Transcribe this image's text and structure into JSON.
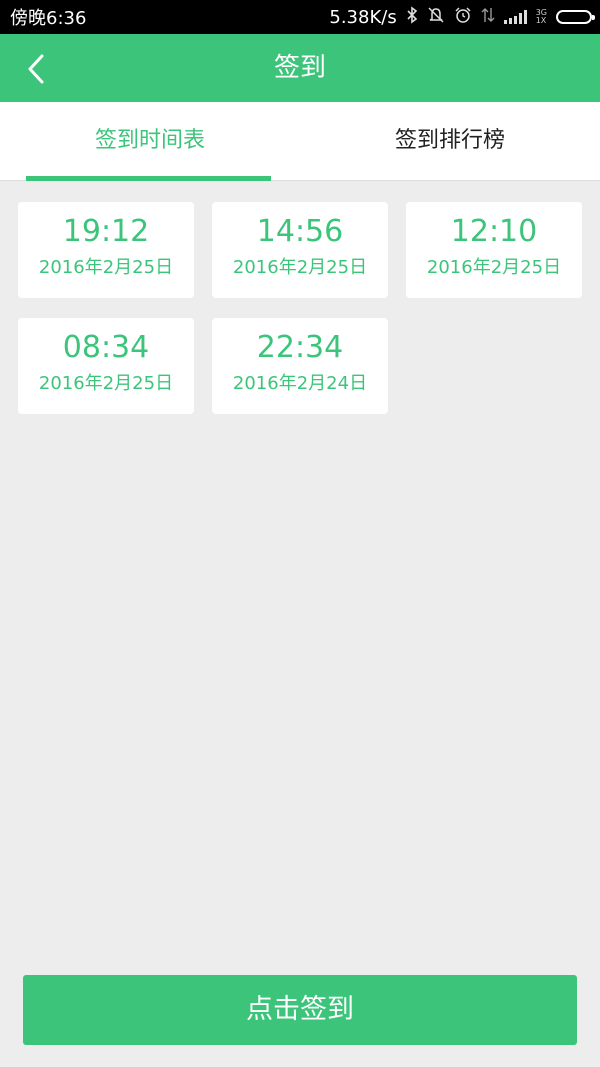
{
  "status_bar": {
    "time": "傍晚6:36",
    "network_speed": "5.38K/s",
    "net_type_top": "3G",
    "net_type_bottom": "1X",
    "icons": [
      "bluetooth-icon",
      "mute-icon",
      "alarm-icon",
      "data-arrows-icon",
      "signal-icon",
      "battery-icon"
    ]
  },
  "header": {
    "title": "签到",
    "back_icon": "chevron-left-icon"
  },
  "tabs": [
    {
      "label": "签到时间表",
      "active": true
    },
    {
      "label": "签到排行榜",
      "active": false
    }
  ],
  "checkins": [
    {
      "time": "19:12",
      "date": "2016年2月25日"
    },
    {
      "time": "14:56",
      "date": "2016年2月25日"
    },
    {
      "time": "12:10",
      "date": "2016年2月25日"
    },
    {
      "time": "08:34",
      "date": "2016年2月25日"
    },
    {
      "time": "22:34",
      "date": "2016年2月24日"
    }
  ],
  "action_button": {
    "label": "点击签到"
  },
  "colors": {
    "accent": "#3cc57a",
    "background": "#ededed",
    "card": "#ffffff",
    "status_bar": "#000000"
  }
}
